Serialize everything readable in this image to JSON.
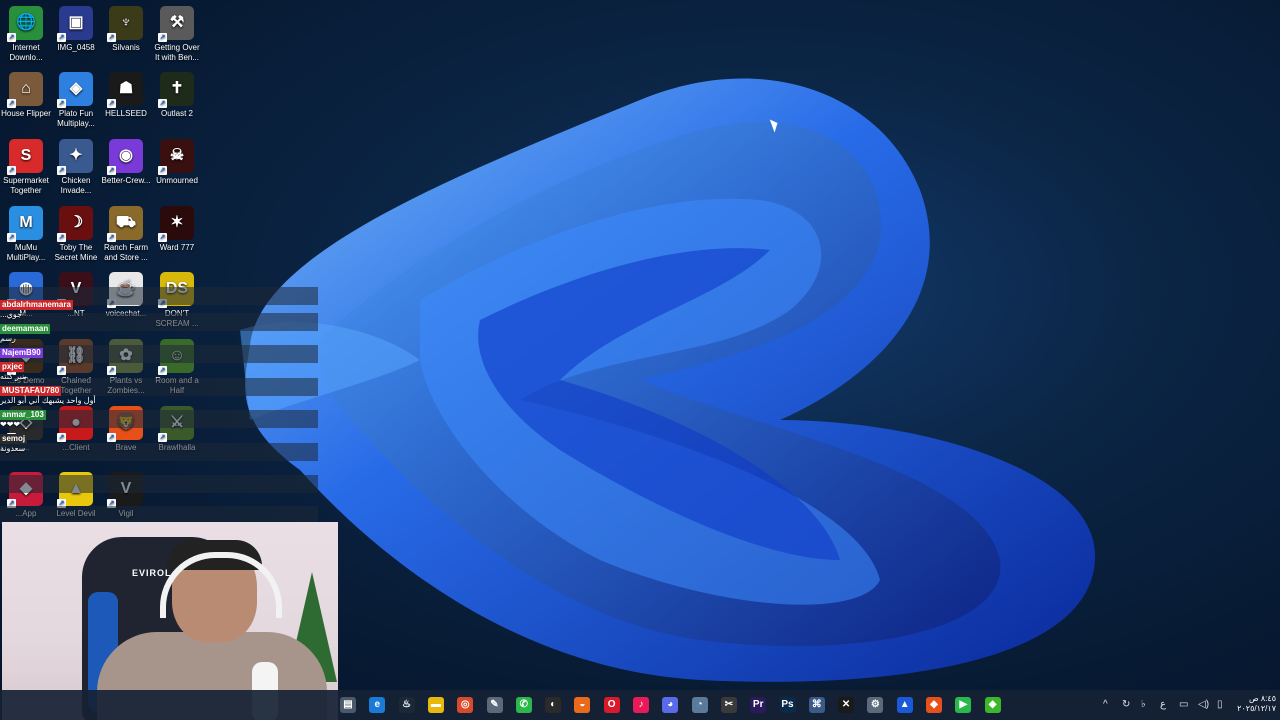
{
  "desktop_icons": [
    {
      "label": "Internet Downlo...",
      "icon": "idm-icon",
      "color": "#2a8f3a",
      "glyph": "🌐"
    },
    {
      "label": "IMG_0458",
      "icon": "image-file-icon",
      "color": "#2a3a8f",
      "glyph": "▣"
    },
    {
      "label": "Silvanis",
      "icon": "silvanis-icon",
      "color": "#3b3b1a",
      "glyph": "♆"
    },
    {
      "label": "Getting Over It with Ben...",
      "icon": "hammer-icon",
      "color": "#5a5a5a",
      "glyph": "⚒"
    },
    {
      "label": "House Flipper",
      "icon": "house-flipper-icon",
      "color": "#7a5a3a",
      "glyph": "⌂"
    },
    {
      "label": "Plato Fun Multiplay...",
      "icon": "plato-icon",
      "color": "#2d7fe0",
      "glyph": "◈"
    },
    {
      "label": "HELLSEED",
      "icon": "hellseed-icon",
      "color": "#1a1a1a",
      "glyph": "☗"
    },
    {
      "label": "Outlast 2",
      "icon": "outlast-icon",
      "color": "#1e2a1a",
      "glyph": "✝"
    },
    {
      "label": "Supermarket Together",
      "icon": "supermarket-icon",
      "color": "#d82a2a",
      "glyph": "S"
    },
    {
      "label": "Chicken Invade...",
      "icon": "chicken-icon",
      "color": "#3a5a8f",
      "glyph": "✦"
    },
    {
      "label": "Better-Crew...",
      "icon": "better-crew-icon",
      "color": "#7a3ad8",
      "glyph": "◉"
    },
    {
      "label": "Unmourned",
      "icon": "unmourned-icon",
      "color": "#3a0f0f",
      "glyph": "☠"
    },
    {
      "label": "MuMu MultiPlay...",
      "icon": "mumu-icon",
      "color": "#2a8fe0",
      "glyph": "M"
    },
    {
      "label": "Toby The Secret Mine",
      "icon": "toby-icon",
      "color": "#6a0f0f",
      "glyph": "☽"
    },
    {
      "label": "Ranch Farm and Store ...",
      "icon": "ranch-icon",
      "color": "#8a6a2a",
      "glyph": "⛟"
    },
    {
      "label": "Ward 777",
      "icon": "ward-icon",
      "color": "#2a0a0a",
      "glyph": "✶"
    },
    {
      "label": "M...",
      "icon": "app-icon",
      "color": "#2a6ad8",
      "glyph": "◍"
    },
    {
      "label": "...NT",
      "icon": "valorant-icon",
      "color": "#3a0f1a",
      "glyph": "V"
    },
    {
      "label": "voicechat...",
      "icon": "java-icon",
      "color": "#e8e8e8",
      "glyph": "☕"
    },
    {
      "label": "DON'T SCREAM ...",
      "icon": "dont-scream-icon",
      "color": "#d8b80a",
      "glyph": "DS"
    },
    {
      "label": "...rs Demo",
      "icon": "demo-icon",
      "color": "#3a2a1a",
      "glyph": "◆"
    },
    {
      "label": "Chained Together",
      "icon": "chained-icon",
      "color": "#5a3a2a",
      "glyph": "⛓"
    },
    {
      "label": "Plants vs Zombies...",
      "icon": "pvz-icon",
      "color": "#4a5a3a",
      "glyph": "✿"
    },
    {
      "label": "Room and a Half",
      "icon": "room-icon",
      "color": "#3a6a2a",
      "glyph": "☺"
    },
    {
      "label": "...",
      "icon": "app-icon",
      "color": "#2a2a2a",
      "glyph": "◇"
    },
    {
      "label": "...Client",
      "icon": "client-icon",
      "color": "#c81a1a",
      "glyph": "●"
    },
    {
      "label": "Brave",
      "icon": "brave-icon",
      "color": "#e8501a",
      "glyph": "🦁"
    },
    {
      "label": "Brawlhalla",
      "icon": "brawlhalla-icon",
      "color": "#3a5a2a",
      "glyph": "⚔"
    },
    {
      "label": "...App",
      "icon": "app-icon",
      "color": "#c81a3a",
      "glyph": "◆"
    },
    {
      "label": "Level Devil",
      "icon": "level-devil-icon",
      "color": "#e8c80a",
      "glyph": "▲"
    },
    {
      "label": "Vigil",
      "icon": "vigil-icon",
      "color": "#1a1a1a",
      "glyph": "V"
    }
  ],
  "chat": [
    {
      "user": "abdalrhmanemara",
      "user_color": "#c8282c",
      "text": "...جوي"
    },
    {
      "user": "deemamaan",
      "user_color": "#2a8f3a",
      "text": "رسم"
    },
    {
      "user": "NajemB90",
      "user_color": "#7a3ad8",
      "text": ""
    },
    {
      "user": "pxjec",
      "user_color": "#c8282c",
      "text": "بنبر كنته"
    },
    {
      "user": "MUSTAFAU780",
      "user_color": "#c8282c",
      "text": "أول واحد يشبهك أني أبو الدير"
    },
    {
      "user": "anmar_103",
      "user_color": "#2a8f3a",
      "text": "❤❤❤"
    },
    {
      "user": "semoj",
      "user_color": "#2a2a2a",
      "text": "سعدونة"
    }
  ],
  "webcam": {
    "chair_brand": "EVIROL"
  },
  "taskbar": {
    "apps": [
      {
        "icon": "task-view-icon",
        "color": "#4a5a6a",
        "glyph": "▤"
      },
      {
        "icon": "edge-icon",
        "color": "#1a7ad8",
        "glyph": "e"
      },
      {
        "icon": "steam-icon",
        "color": "#1b2838",
        "glyph": "♨"
      },
      {
        "icon": "file-explorer-icon",
        "color": "#e8b80a",
        "glyph": "▬"
      },
      {
        "icon": "chrome-icon",
        "color": "#d84a2a",
        "glyph": "◎"
      },
      {
        "icon": "notepad-icon",
        "color": "#5a6a7a",
        "glyph": "✎"
      },
      {
        "icon": "whatsapp-icon",
        "color": "#2ab84a",
        "glyph": "✆"
      },
      {
        "icon": "obs-icon",
        "color": "#2a2a2a",
        "glyph": "◐"
      },
      {
        "icon": "origin-icon",
        "color": "#e86a1a",
        "glyph": "◒"
      },
      {
        "icon": "opera-icon",
        "color": "#d81a2a",
        "glyph": "O"
      },
      {
        "icon": "tiktok-icon",
        "color": "#e81a5a",
        "glyph": "♪"
      },
      {
        "icon": "discord-icon",
        "color": "#5a6ae8",
        "glyph": "◕"
      },
      {
        "icon": "app-icon",
        "color": "#5a7a9a",
        "glyph": "◔"
      },
      {
        "icon": "capcut-icon",
        "color": "#3a3a3a",
        "glyph": "✂"
      },
      {
        "icon": "premiere-icon",
        "color": "#2a1a5a",
        "glyph": "Pr"
      },
      {
        "icon": "photoshop-icon",
        "color": "#0a2a4a",
        "glyph": "Ps"
      },
      {
        "icon": "gamepad-icon",
        "color": "#3a5a8a",
        "glyph": "⌘"
      },
      {
        "icon": "capcut-alt-icon",
        "color": "#1a1a1a",
        "glyph": "✕"
      },
      {
        "icon": "settings-icon",
        "color": "#5a6a7a",
        "glyph": "⚙"
      },
      {
        "icon": "nord-icon",
        "color": "#1a5ad8",
        "glyph": "▲"
      },
      {
        "icon": "brave-taskbar-icon",
        "color": "#e8501a",
        "glyph": "◆"
      },
      {
        "icon": "media-icon",
        "color": "#2ab84a",
        "glyph": "▶"
      },
      {
        "icon": "app-green-icon",
        "color": "#3ab82a",
        "glyph": "◆"
      }
    ],
    "tray": [
      {
        "icon": "chevron-up-icon",
        "glyph": "^"
      },
      {
        "icon": "sync-icon",
        "glyph": "↻"
      },
      {
        "icon": "mic-icon",
        "glyph": "♭"
      },
      {
        "icon": "language-icon",
        "glyph": "ع"
      },
      {
        "icon": "network-icon",
        "glyph": "▭"
      },
      {
        "icon": "volume-icon",
        "glyph": "◁)"
      },
      {
        "icon": "battery-icon",
        "glyph": "▯"
      }
    ],
    "time": "٨:٤٥ ص",
    "date": "٢٠٢٥/١٢/١٧"
  }
}
